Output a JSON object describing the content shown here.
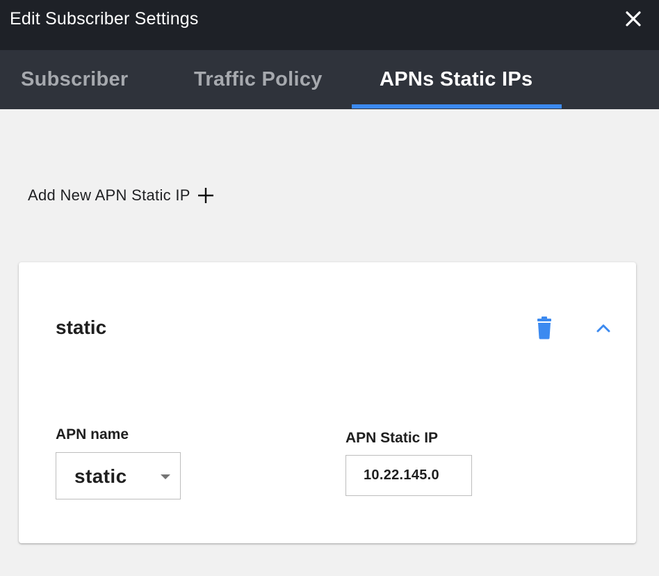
{
  "dialog": {
    "title": "Edit Subscriber Settings"
  },
  "tabs": [
    {
      "label": "Subscriber",
      "active": false
    },
    {
      "label": "Traffic Policy",
      "active": false
    },
    {
      "label": "APNs Static IPs",
      "active": true
    }
  ],
  "add_apn": {
    "label": "Add New APN Static IP",
    "icon": "plus-icon"
  },
  "apn_card": {
    "title": "static",
    "delete_icon": "trash-icon",
    "expand_icon": "chevron-up-icon",
    "apn_name": {
      "label": "APN name",
      "value": "static"
    },
    "apn_static_ip": {
      "label": "APN Static IP",
      "value": "10.22.145.0"
    }
  },
  "colors": {
    "titlebar": "#1e2127",
    "tabbar": "#2f333b",
    "accent": "#3c8af0",
    "background": "#f1f1f1"
  }
}
